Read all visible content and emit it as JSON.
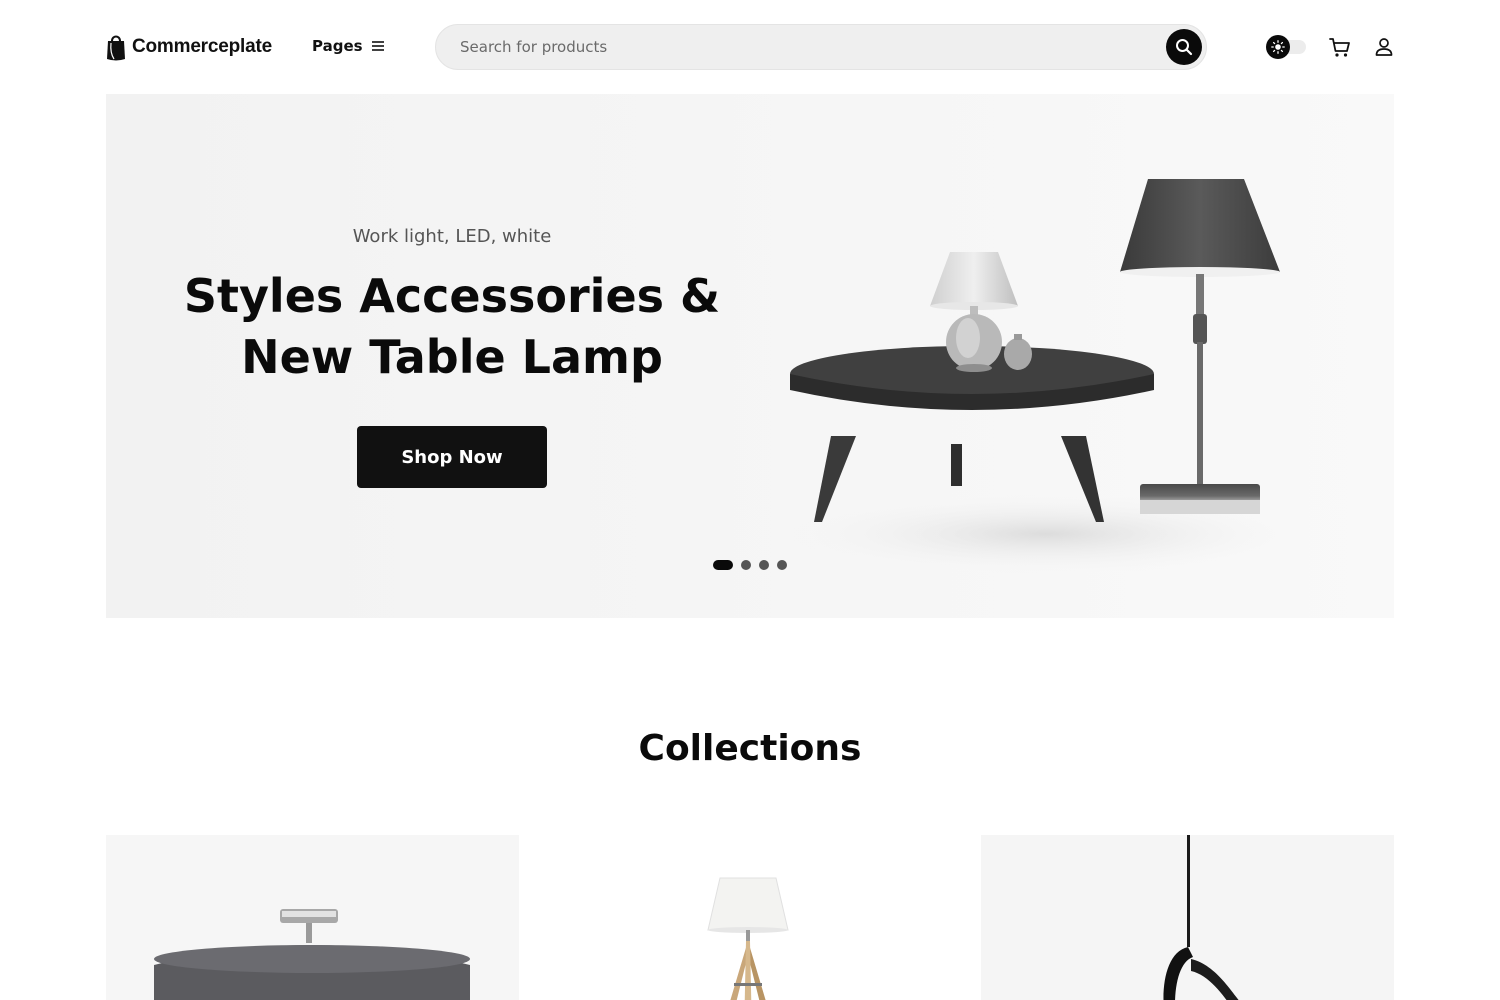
{
  "brand": {
    "name": "Commerceplate",
    "logo_icon": "shopping-bag-icon"
  },
  "nav": {
    "pages_label": "Pages",
    "pages_icon": "hamburger-menu-icon"
  },
  "search": {
    "placeholder": "Search for products",
    "button_icon": "search-icon"
  },
  "header_actions": {
    "theme_toggle_icon": "sun-icon",
    "cart_icon": "cart-icon",
    "user_icon": "user-icon"
  },
  "hero": {
    "subtitle": "Work light, LED, white",
    "title_line1": "Styles Accessories &",
    "title_line2": "New Table Lamp",
    "cta_label": "Shop Now",
    "slides_total": 4,
    "active_slide": 1
  },
  "collections": {
    "title": "Collections",
    "items": [
      {
        "image": "ceiling-lamp-shade"
      },
      {
        "image": "tripod-floor-lamp"
      },
      {
        "image": "pendant-lamp"
      }
    ]
  },
  "colors": {
    "primary": "#111111",
    "hero_bg": "#f5f5f5",
    "search_bg": "#efefef",
    "text_muted": "#555555"
  }
}
